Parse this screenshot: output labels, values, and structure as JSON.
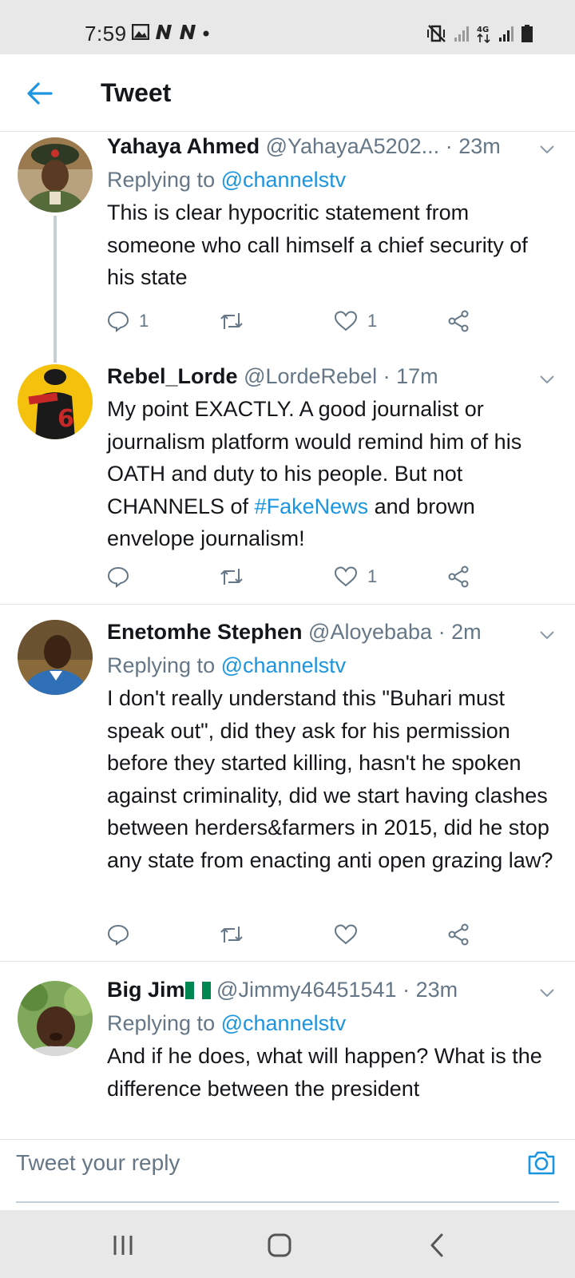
{
  "status_bar": {
    "time": "7:59",
    "left_icons": [
      "gallery-icon",
      "notification-n-icon",
      "notification-n-icon",
      "dot-icon"
    ],
    "right_icons": [
      "vibrate-mute-icon",
      "signal-icon",
      "4g-icon",
      "signal-icon",
      "battery-icon"
    ],
    "network_label": "4G"
  },
  "header": {
    "title": "Tweet",
    "back_icon": "arrow-left-icon"
  },
  "colors": {
    "accent": "#1b95e0",
    "muted": "#657786",
    "text": "#14171a",
    "divider": "#dfe3e6"
  },
  "tweets": [
    {
      "name": "Yahaya Ahmed",
      "handle": "@YahayaA5202...",
      "dot": "·",
      "time": "23m",
      "replying_prefix": "Replying to",
      "replying_to": "@channelstv",
      "text": "This is clear hypocritic statement from someone who call himself a chief security of his state",
      "reply_count": "1",
      "like_count": "1"
    },
    {
      "name": "Rebel_Lorde",
      "handle": "@LordeRebel",
      "dot": "·",
      "time": "17m",
      "text_before": "My point EXACTLY. A good journalist or journalism platform would remind him of his OATH and duty to his people. But not CHANNELS of ",
      "hashtag": "#FakeNews",
      "text_after": " and brown envelope journalism!",
      "reply_count": "",
      "like_count": "1"
    },
    {
      "name": "Enetomhe Stephen",
      "handle": "@Aloyebaba",
      "dot": "·",
      "time": "2m",
      "replying_prefix": "Replying to",
      "replying_to": "@channelstv",
      "text": "I don't really understand this \"Buhari must speak out\", did they ask for his permission before they started killing, hasn't he spoken against criminality, did we start having clashes between herders&farmers in 2015, did he stop any state from enacting anti open grazing law?",
      "reply_count": "",
      "like_count": ""
    },
    {
      "name": "Big Jim",
      "flag": "nigeria-flag-icon",
      "handle": "@Jimmy46451541",
      "dot": "·",
      "time": "23m",
      "replying_prefix": "Replying to",
      "replying_to": "@channelstv",
      "text": "And if he does, what will happen? What is the difference between the president"
    }
  ],
  "reply_box": {
    "placeholder": "Tweet your reply",
    "camera_icon": "camera-icon"
  },
  "nav": {
    "buttons": [
      "recent-apps-icon",
      "home-icon",
      "back-icon"
    ]
  }
}
